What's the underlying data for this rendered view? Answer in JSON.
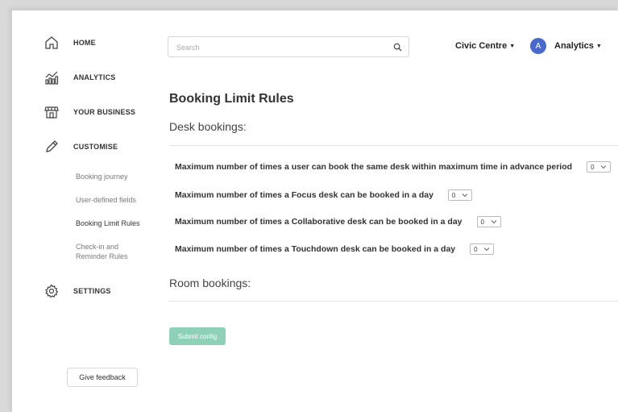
{
  "sidebar": {
    "items": [
      {
        "label": "HOME",
        "icon": "home-icon"
      },
      {
        "label": "ANALYTICS",
        "icon": "analytics-icon"
      },
      {
        "label": "YOUR BUSINESS",
        "icon": "store-icon"
      },
      {
        "label": "CUSTOMISE",
        "icon": "pencil-icon"
      },
      {
        "label": "SETTINGS",
        "icon": "gear-icon"
      }
    ],
    "customise_sub": [
      {
        "label": "Booking journey"
      },
      {
        "label": "User-defined fields"
      },
      {
        "label": "Booking Limit Rules"
      },
      {
        "label": "Check-in and Reminder Rules"
      }
    ],
    "feedback_label": "Give feedback"
  },
  "header": {
    "search_placeholder": "Search",
    "venue": "Civic Centre",
    "avatar_initial": "A",
    "user_menu": "Analytics"
  },
  "main": {
    "title": "Booking Limit Rules",
    "desk_section": "Desk bookings:",
    "rules": [
      {
        "label": "Maximum number of times a user can book the same desk within maximum time in advance period",
        "value": "0"
      },
      {
        "label": "Maximum number of times a Focus desk can be booked in a day",
        "value": "0"
      },
      {
        "label": "Maximum number of times a Collaborative desk can be booked in a day",
        "value": "0"
      },
      {
        "label": "Maximum number of times a Touchdown desk can be booked in a day",
        "value": "0"
      }
    ],
    "room_section": "Room bookings:",
    "submit_label": "Submit config"
  },
  "colors": {
    "accent": "#4a69c8",
    "submit": "#8fd0b9"
  }
}
